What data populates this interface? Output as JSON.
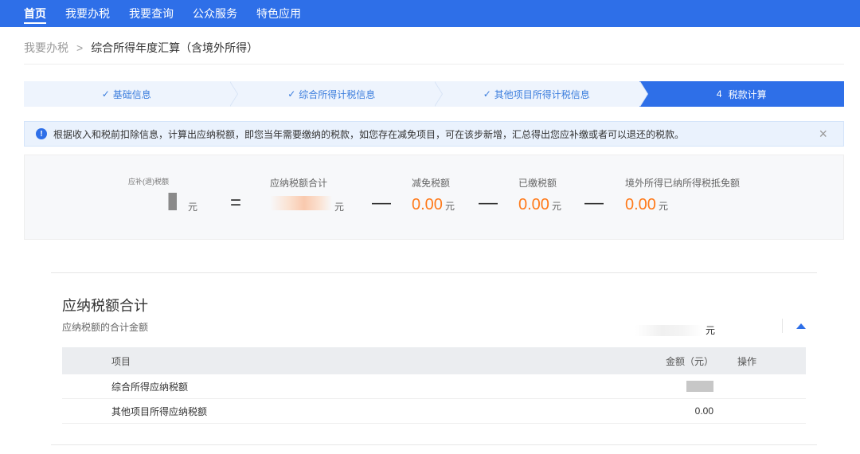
{
  "nav": {
    "items": [
      {
        "label": "首页"
      },
      {
        "label": "我要办税"
      },
      {
        "label": "我要查询"
      },
      {
        "label": "公众服务"
      },
      {
        "label": "特色应用"
      }
    ]
  },
  "breadcrumb": {
    "parent": "我要办税",
    "separator": ">",
    "current": "综合所得年度汇算（含境外所得）"
  },
  "steps": [
    {
      "label": "基础信息",
      "prefix": "✓"
    },
    {
      "label": "综合所得计税信息",
      "prefix": "✓"
    },
    {
      "label": "其他项目所得计税信息",
      "prefix": "✓"
    },
    {
      "label": "税款计算",
      "prefix": "4"
    }
  ],
  "notice": {
    "icon": "info-icon",
    "text": "根据收入和税前扣除信息，计算出应纳税额，即您当年需要缴纳的税款，如您存在减免项目，可在该步新增，汇总得出您应补缴或者可以退还的税款。",
    "close": "×"
  },
  "equation": {
    "result": {
      "label": "应补(退)税额",
      "unit": "元"
    },
    "equals": "=",
    "total_tax": {
      "label": "应纳税额合计",
      "unit": "元"
    },
    "minus": "—",
    "reduction": {
      "label": "减免税额",
      "value": "0.00",
      "unit": "元"
    },
    "paid": {
      "label": "已缴税额",
      "value": "0.00",
      "unit": "元"
    },
    "foreign_credit": {
      "label": "境外所得已纳所得税抵免额",
      "value": "0.00",
      "unit": "元"
    }
  },
  "section": {
    "title": "应纳税额合计",
    "subtitle": "应纳税额的合计金额",
    "unit": "元",
    "table": {
      "headers": {
        "item": "项目",
        "amount": "金额（元）",
        "action": "操作"
      },
      "rows": [
        {
          "item": "综合所得应纳税额",
          "amount": ""
        },
        {
          "item": "其他项目所得应纳税额",
          "amount": "0.00"
        }
      ]
    }
  },
  "colors": {
    "primary": "#2e6fe8",
    "accent": "#ff7a1a"
  }
}
